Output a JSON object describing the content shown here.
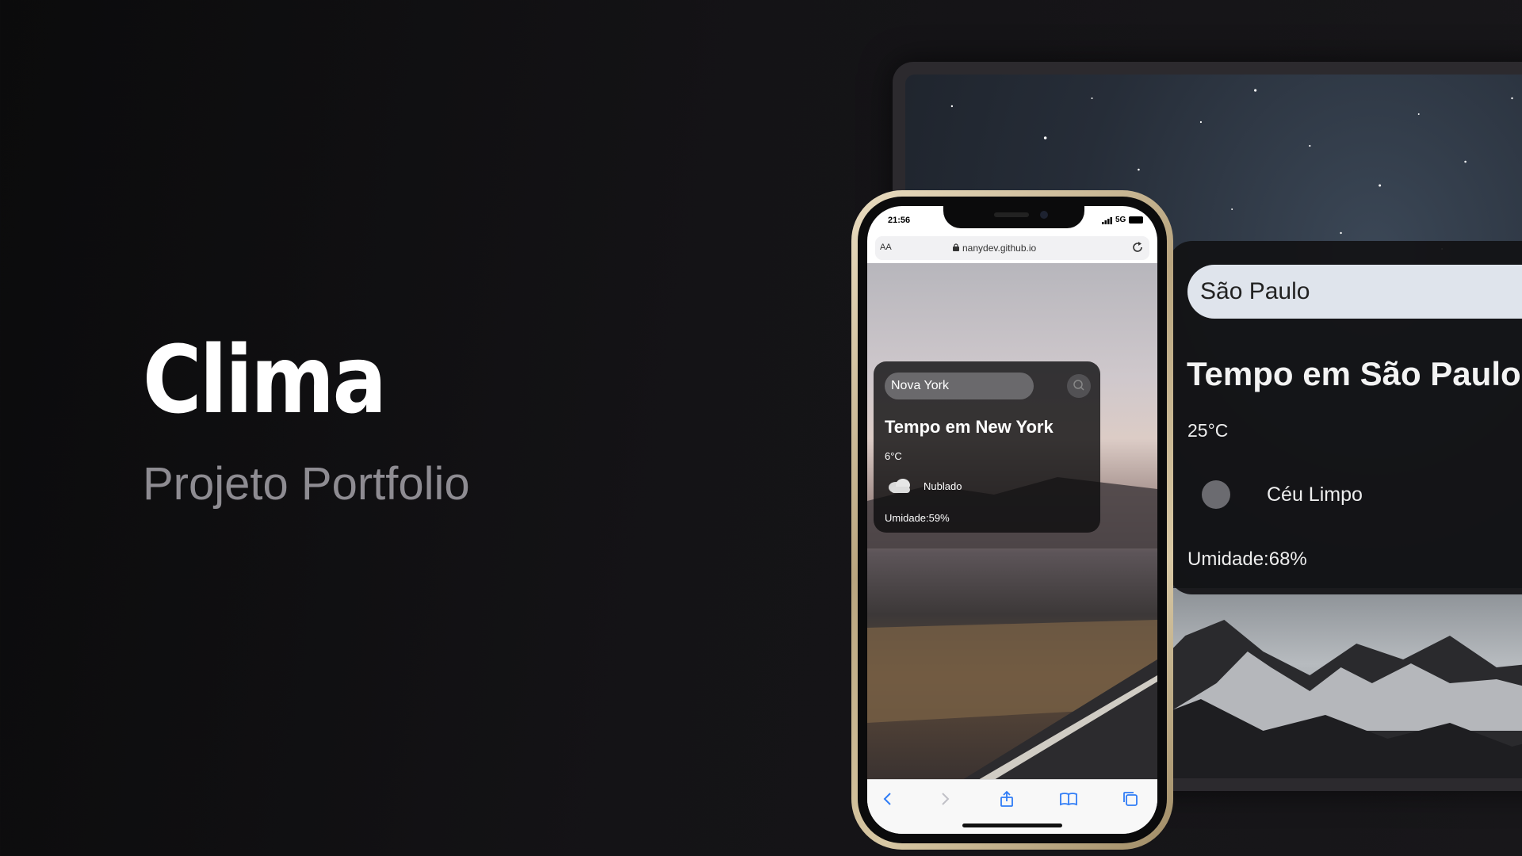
{
  "hero": {
    "title": "Clima",
    "subtitle": "Projeto Portfolio"
  },
  "desktop": {
    "search_value": "São Paulo",
    "heading": "Tempo em São Paulo",
    "temperature": "25°C",
    "description": "Céu Limpo",
    "humidity": "Umidade:68%"
  },
  "phone": {
    "status": {
      "time": "21:56",
      "network": "5G"
    },
    "browser": {
      "text_size": "AA",
      "url": "nanydev.github.io"
    },
    "weather": {
      "search_value": "Nova York",
      "heading": "Tempo em New York",
      "temperature": "6°C",
      "description": "Nublado",
      "humidity": "Umidade:59%"
    },
    "toolbar_icons": [
      "back-icon",
      "forward-icon",
      "share-icon",
      "bookmarks-icon",
      "tabs-icon"
    ]
  },
  "colors": {
    "background": "#111013",
    "subtitle": "#8e8c92",
    "phone_frame": "#c9b68f",
    "ios_blue": "#2f7cf6"
  }
}
